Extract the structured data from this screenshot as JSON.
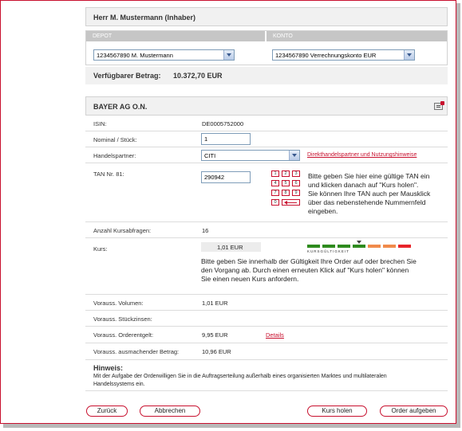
{
  "header": {
    "title": "Herr M. Mustermann (Inhaber)"
  },
  "depot": {
    "label": "DEPOT",
    "selected": "1234567890 M. Mustermann"
  },
  "konto": {
    "label": "KONTO",
    "selected": "1234567890 Verrechnungskonto EUR"
  },
  "available": {
    "label": "Verfügbarer Betrag:",
    "value": "10.372,70 EUR"
  },
  "security": {
    "title": "BAYER AG O.N.",
    "icon": "export-icon"
  },
  "fields": {
    "isin_label": "ISIN:",
    "isin_value": "DE0005752000",
    "nominal_label": "Nominal / Stück:",
    "nominal_value": "1",
    "partner_label": "Handelspartner:",
    "partner_value": "CITI",
    "partner_link": "Direkthandelspartner und Nutzungshinweise",
    "tan_label": "TAN Nr. 81:",
    "tan_value": "290942",
    "tan_hint": [
      "Bitte geben Sie hier eine gültige TAN ein",
      "und klicken danach auf \"Kurs holen\".",
      "Sie können Ihre TAN auch per Mausklick",
      "über das nebenstehende Nummernfeld",
      "eingeben."
    ],
    "keypad": [
      "1",
      "2",
      "3",
      "4",
      "5",
      "6",
      "7",
      "8",
      "9",
      "0"
    ],
    "queries_label": "Anzahl Kursabfragen:",
    "queries_value": "16",
    "kurs_label": "Kurs:",
    "kurs_value": "1,01 EUR",
    "validity_label": "KURSGÜLTIGKEIT",
    "validity_level": 3,
    "kurs_hint": [
      "Bitte geben Sie innerhalb der Gültigkeit Ihre Order auf oder brechen Sie",
      "den Vorgang ab. Durch einen erneuten Klick auf \"Kurs holen\" können",
      "Sie einen neuen Kurs anfordern."
    ],
    "volume_label": "Vorauss. Volumen:",
    "volume_value": "1,01 EUR",
    "interest_label": "Vorauss. Stückzinsen:",
    "interest_value": "",
    "fee_label": "Vorauss. Orderentgelt:",
    "fee_value": "9,95 EUR",
    "fee_link": "Details",
    "total_label": "Vorauss. ausmachender Betrag:",
    "total_value": "10,96 EUR"
  },
  "note": {
    "title": "Hinweis:",
    "text": [
      "Mit der Aufgabe der Orderwilligen Sie in die Auftragserteilung außerhalb eines organisierten Marktes und multilateralen",
      "Handelssystems ein."
    ]
  },
  "buttons": {
    "back": "Zurück",
    "cancel": "Abbrechen",
    "quote": "Kurs holen",
    "order": "Order aufgeben"
  },
  "colors": {
    "accent": "#c8102e",
    "validity": [
      "#2e8b1e",
      "#2e8b1e",
      "#2e8b1e",
      "#2e8b1e",
      "#f08a4b",
      "#f08a4b",
      "#e8242a"
    ]
  }
}
